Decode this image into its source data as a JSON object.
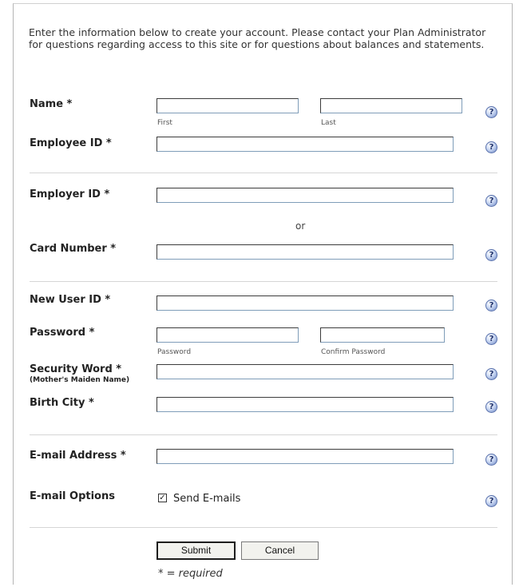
{
  "intro": "Enter the information below to create your account. Please contact your Plan Administrator for questions regarding access to this site or for questions about balances and statements.",
  "help_glyph": "?",
  "fields": {
    "name": {
      "label": "Name *",
      "first_hint": "First",
      "last_hint": "Last",
      "first_value": "",
      "last_value": ""
    },
    "employee_id": {
      "label": "Employee ID *",
      "value": ""
    },
    "employer_id": {
      "label": "Employer ID *",
      "value": ""
    },
    "or_text": "or",
    "card_number": {
      "label": "Card Number *",
      "value": ""
    },
    "new_user_id": {
      "label": "New User ID *",
      "value": ""
    },
    "password": {
      "label": "Password *",
      "password_hint": "Password",
      "confirm_hint": "Confirm Password"
    },
    "security_word": {
      "label": "Security Word *",
      "sublabel": "(Mother's Maiden Name)",
      "value": ""
    },
    "birth_city": {
      "label": "Birth City *",
      "value": ""
    },
    "email": {
      "label": "E-mail Address *",
      "value": ""
    },
    "email_options": {
      "label": "E-mail Options",
      "checkbox_label": "Send E-mails",
      "checked": true,
      "check_glyph": "✓"
    }
  },
  "buttons": {
    "submit": "Submit",
    "cancel": "Cancel"
  },
  "required_note": "* = required",
  "colors": {
    "input_border": "#7f9db9",
    "help_icon": "#6c86c4"
  }
}
